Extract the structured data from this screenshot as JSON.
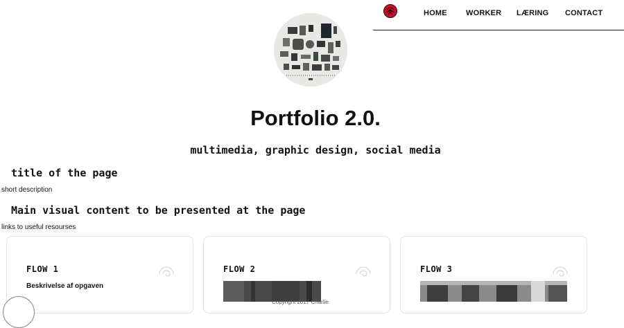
{
  "nav": {
    "logo_icon": "rose-icon",
    "items": [
      {
        "label": "HOME"
      },
      {
        "label": "WORKER"
      },
      {
        "label": "LÆRING"
      },
      {
        "label": "CONTACT"
      }
    ]
  },
  "hero": {
    "title": "Portfolio 2.0.",
    "subtitle": "multimedia, graphic design, social media"
  },
  "sections": [
    {
      "heading": "title of the page",
      "text": "short description"
    },
    {
      "heading": "Main visual content to be presented at the page",
      "text": "links to useful resourses"
    }
  ],
  "cards": [
    {
      "title": "FLOW 1",
      "description": "Beskrivelse af opgaven",
      "icon": "spiral-icon"
    },
    {
      "title": "FLOW 2",
      "icon": "spiral-icon"
    },
    {
      "title": "FLOW 3",
      "icon": "spiral-icon"
    }
  ],
  "footer": {
    "copyright": "Copyright 2017 Charlie"
  },
  "colors": {
    "accent": "#c8102e",
    "text": "#111111",
    "card_border": "#e3e3e3"
  }
}
